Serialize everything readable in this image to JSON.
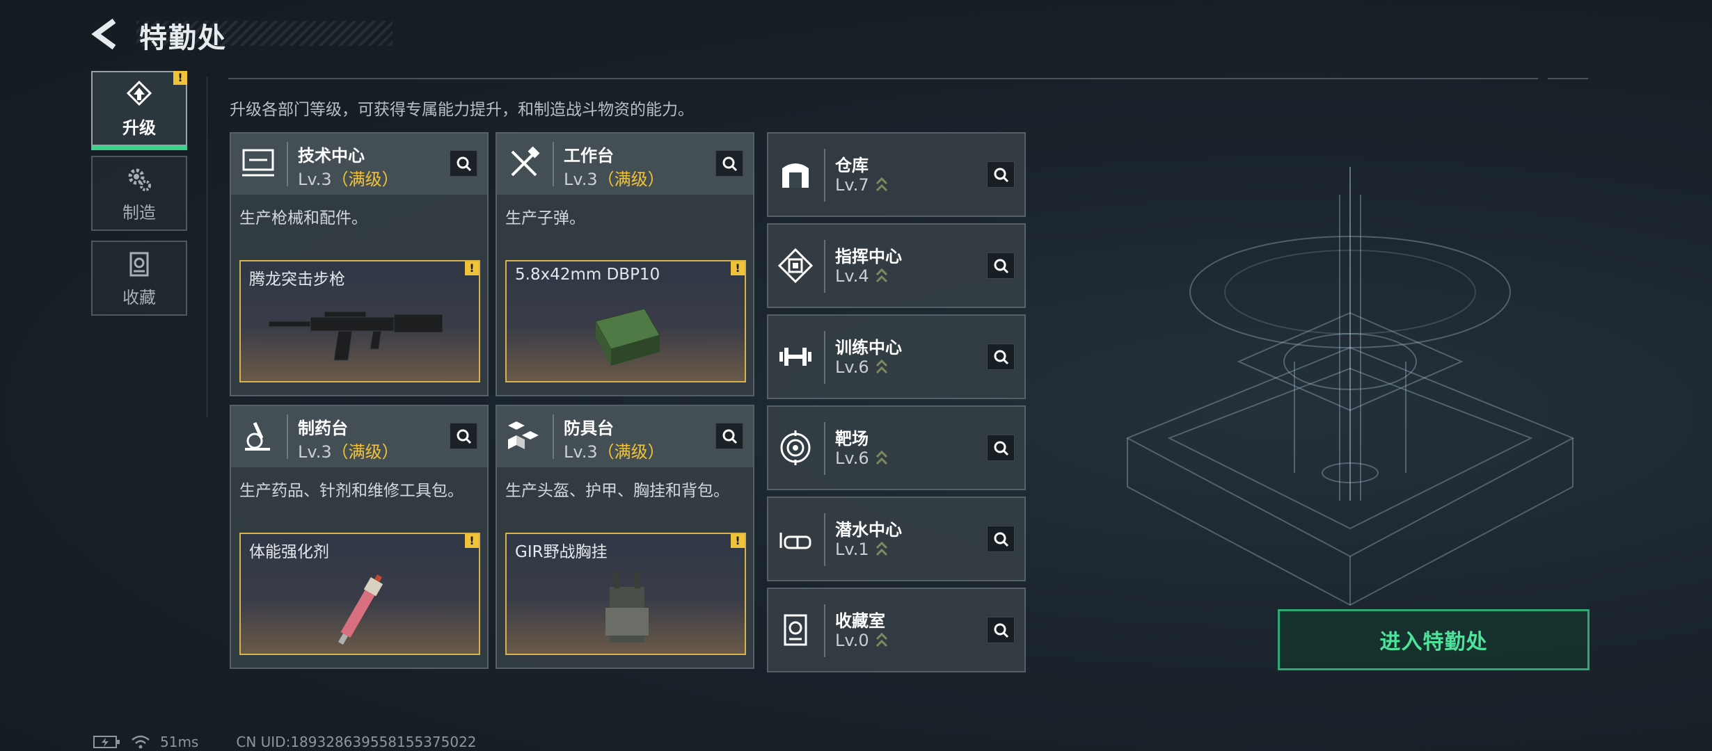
{
  "header": {
    "title": "特勤处"
  },
  "tabs": [
    {
      "label": "升级",
      "active": true,
      "icon": "upgrade-icon",
      "warn": "!"
    },
    {
      "label": "制造",
      "active": false,
      "icon": "gears-icon"
    },
    {
      "label": "收藏",
      "active": false,
      "icon": "collection-icon"
    }
  ],
  "description": "升级各部门等级，可获得专属能力提升，和制造战斗物资的能力。",
  "cards": [
    {
      "name": "技术中心",
      "level": "Lv.3",
      "maxed": "（满级）",
      "desc": "生产枪械和配件。",
      "product": "腾龙突击步枪",
      "warn": "!",
      "icon": "computer-icon"
    },
    {
      "name": "工作台",
      "level": "Lv.3",
      "maxed": "（满级）",
      "desc": "生产子弹。",
      "product": "5.8x42mm DBP10",
      "warn": "!",
      "icon": "tools-icon"
    },
    {
      "name": "制药台",
      "level": "Lv.3",
      "maxed": "（满级）",
      "desc": "生产药品、针剂和维修工具包。",
      "product": "体能强化剂",
      "warn": "!",
      "icon": "microscope-icon"
    },
    {
      "name": "防具台",
      "level": "Lv.3",
      "maxed": "（满级）",
      "desc": "生产头盔、护甲、胸挂和背包。",
      "product": "GIR野战胸挂",
      "warn": "!",
      "icon": "boxes-icon"
    }
  ],
  "facilities": [
    {
      "name": "仓库",
      "level": "Lv.7",
      "icon": "warehouse-icon"
    },
    {
      "name": "指挥中心",
      "level": "Lv.4",
      "icon": "chip-icon"
    },
    {
      "name": "训练中心",
      "level": "Lv.6",
      "icon": "dumbbell-icon"
    },
    {
      "name": "靶场",
      "level": "Lv.6",
      "icon": "target-icon"
    },
    {
      "name": "潜水中心",
      "level": "Lv.1",
      "icon": "goggles-icon"
    },
    {
      "name": "收藏室",
      "level": "Lv.0",
      "icon": "vault-icon"
    }
  ],
  "enter_button": "进入特勤处",
  "footer": {
    "ping": "51ms",
    "uid": "CN UID:1893286395581553750​22"
  },
  "colors": {
    "accent_green": "#4ee39b",
    "gold": "#f0c33a"
  }
}
